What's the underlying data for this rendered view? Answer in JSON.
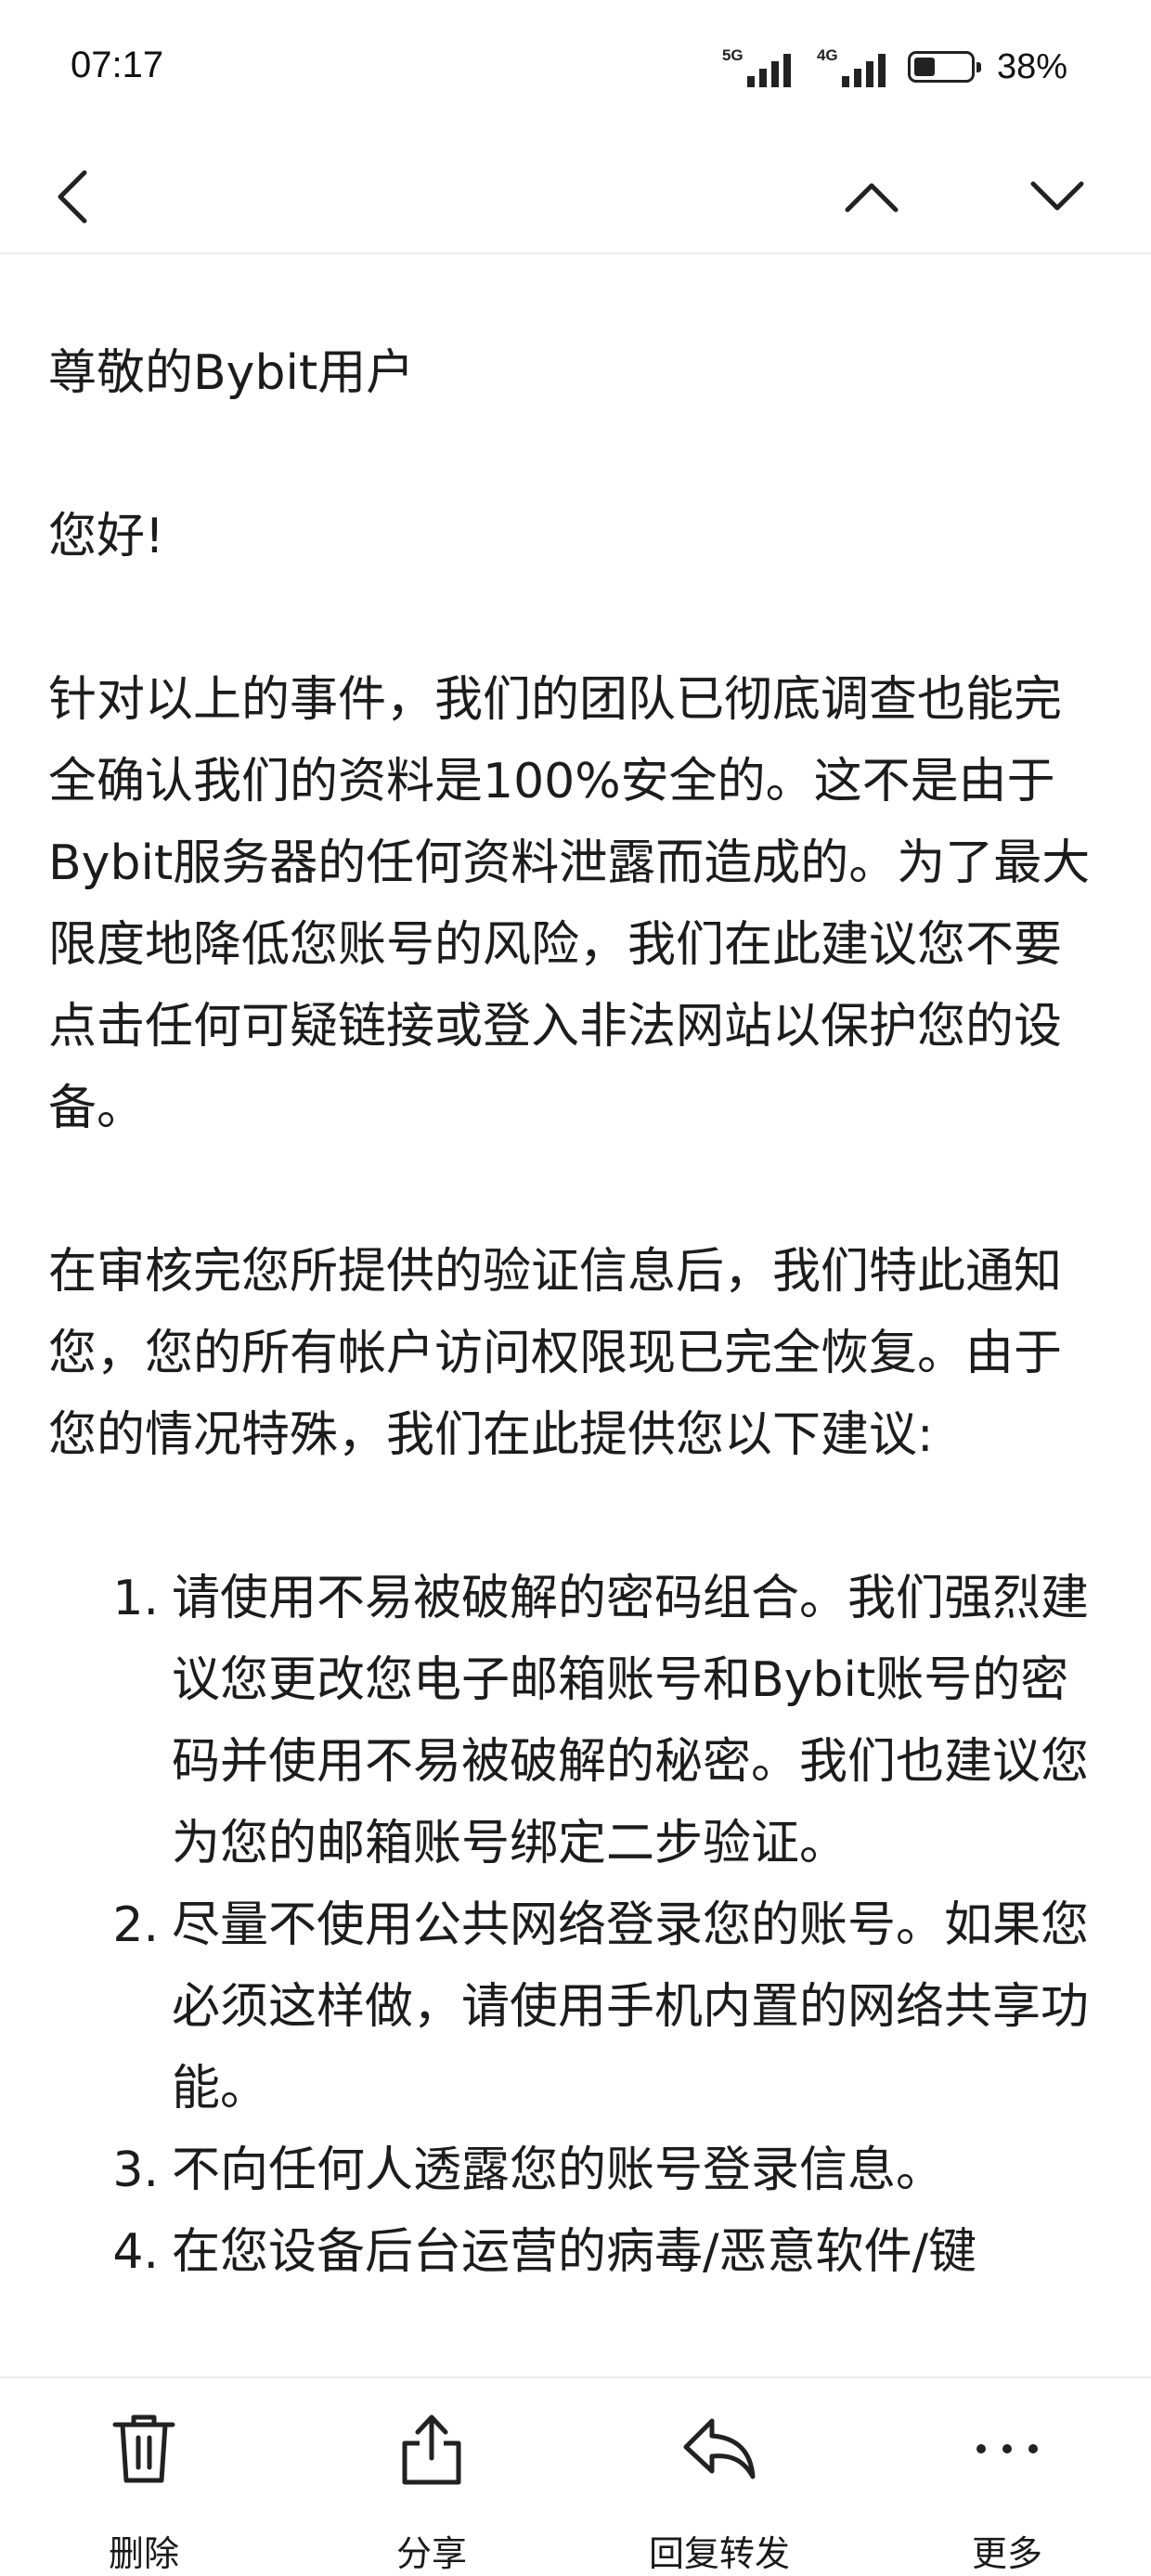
{
  "status_bar": {
    "time": "07:17",
    "signal1_label": "5G",
    "signal2_label": "4G",
    "battery_percent": "38%",
    "battery_level": 0.38
  },
  "nav": {
    "back_icon": "chevron-left-icon",
    "prev_icon": "chevron-up-icon",
    "next_icon": "chevron-down-icon"
  },
  "email": {
    "salutation": "尊敬的Bybit用户",
    "greeting": "您好!",
    "paragraph1": "针对以上的事件，我们的团队已彻底调查也能完全确认我们的资料是100%安全的。这不是由于Bybit服务器的任何资料泄露而造成的。为了最大限度地降低您账号的风险，我们在此建议您不要点击任何可疑链接或登入非法网站以保护您的设备。",
    "paragraph2": "在审核完您所提供的验证信息后，我们特此通知您，您的所有帐户访问权限现已完全恢复。由于您的情况特殊，我们在此提供您以下建议:",
    "list": [
      {
        "num": "1.",
        "text": "请使用不易被破解的密码组合。我们强烈建议您更改您电子邮箱账号和Bybit账号的密码并使用不易被破解的秘密。我们也建议您为您的邮箱账号绑定二步验证。"
      },
      {
        "num": "2.",
        "text": "尽量不使用公共网络登录您的账号。如果您必须这样做，请使用手机内置的网络共享功能。"
      },
      {
        "num": "3.",
        "text": "不向任何人透露您的账号登录信息。"
      },
      {
        "num": "4.",
        "text": "在您设备后台运营的病毒/恶意软件/键"
      }
    ]
  },
  "bottom_actions": [
    {
      "label": "删除",
      "icon": "trash-icon"
    },
    {
      "label": "分享",
      "icon": "share-icon"
    },
    {
      "label": "回复转发",
      "icon": "reply-icon"
    },
    {
      "label": "更多",
      "icon": "more-icon"
    }
  ],
  "colors": {
    "text": "#1c1c1c",
    "background": "#ffffff",
    "divider": "#ececec"
  }
}
